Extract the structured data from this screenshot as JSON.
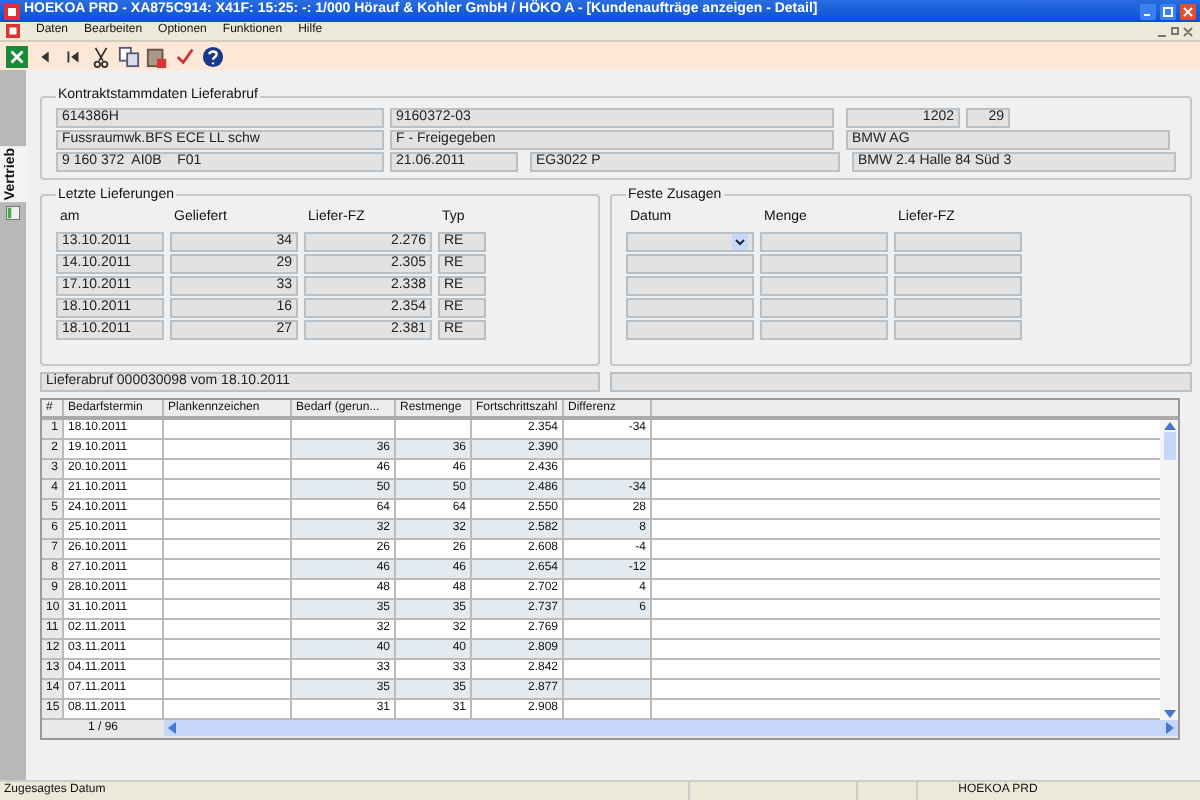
{
  "window": {
    "title": "HOEKOA PRD - XA875C914: X41F: 15:25: -: 1/000 Hörauf & Kohler GmbH / HÖKO A - [Kundenaufträge anzeigen - Detail]"
  },
  "menu": [
    "Daten",
    "Bearbeiten",
    "Optionen",
    "Funktionen",
    "Hilfe"
  ],
  "side_tab": {
    "label": "Vertrieb"
  },
  "contract": {
    "title": "Kontraktstammdaten Lieferabruf",
    "fields": [
      "614386H",
      "9160372-03",
      "1202",
      "29",
      "Fussraumwk.BFS ECE LL schw",
      "F - Freigegeben",
      "BMW AG",
      "9 160 372  AI0B    F01",
      "21.06.2011",
      "EG3022 P",
      "BMW 2.4 Halle 84 Süd 3"
    ]
  },
  "deliveries": {
    "title": "Letzte Lieferungen",
    "columns": [
      "am",
      "Geliefert",
      "Liefer-FZ",
      "Typ"
    ],
    "rows": [
      [
        "13.10.2011",
        "34",
        "2.276",
        "RE"
      ],
      [
        "14.10.2011",
        "29",
        "2.305",
        "RE"
      ],
      [
        "17.10.2011",
        "33",
        "2.338",
        "RE"
      ],
      [
        "18.10.2011",
        "16",
        "2.354",
        "RE"
      ],
      [
        "18.10.2011",
        "27",
        "2.381",
        "RE"
      ]
    ]
  },
  "commitments": {
    "title": "Feste Zusagen",
    "columns": [
      "Datum",
      "Menge",
      "Liefer-FZ"
    ]
  },
  "call_off": "Lieferabruf 000030098 vom 18.10.2011",
  "table": {
    "columns": [
      "#",
      "Bedarfstermin",
      "Plankennzeichen",
      "Bedarf (gerun...",
      "Restmenge",
      "Fortschrittszahl",
      "Differenz"
    ],
    "rows": [
      [
        "1",
        "18.10.2011",
        "",
        "",
        "",
        "2.354",
        "-34"
      ],
      [
        "2",
        "19.10.2011",
        "",
        "36",
        "36",
        "2.390",
        ""
      ],
      [
        "3",
        "20.10.2011",
        "",
        "46",
        "46",
        "2.436",
        ""
      ],
      [
        "4",
        "21.10.2011",
        "",
        "50",
        "50",
        "2.486",
        "-34"
      ],
      [
        "5",
        "24.10.2011",
        "",
        "64",
        "64",
        "2.550",
        "28"
      ],
      [
        "6",
        "25.10.2011",
        "",
        "32",
        "32",
        "2.582",
        "8"
      ],
      [
        "7",
        "26.10.2011",
        "",
        "26",
        "26",
        "2.608",
        "-4"
      ],
      [
        "8",
        "27.10.2011",
        "",
        "46",
        "46",
        "2.654",
        "-12"
      ],
      [
        "9",
        "28.10.2011",
        "",
        "48",
        "48",
        "2.702",
        "4"
      ],
      [
        "10",
        "31.10.2011",
        "",
        "35",
        "35",
        "2.737",
        "6"
      ],
      [
        "11",
        "02.11.2011",
        "",
        "32",
        "32",
        "2.769",
        ""
      ],
      [
        "12",
        "03.11.2011",
        "",
        "40",
        "40",
        "2.809",
        ""
      ],
      [
        "13",
        "04.11.2011",
        "",
        "33",
        "33",
        "2.842",
        ""
      ],
      [
        "14",
        "07.11.2011",
        "",
        "35",
        "35",
        "2.877",
        ""
      ],
      [
        "15",
        "08.11.2011",
        "",
        "31",
        "31",
        "2.908",
        ""
      ]
    ],
    "pager": "1 / 96"
  },
  "status_bar": {
    "message": "Zugesagtes Datum",
    "system": "HOEKOA PRD"
  }
}
